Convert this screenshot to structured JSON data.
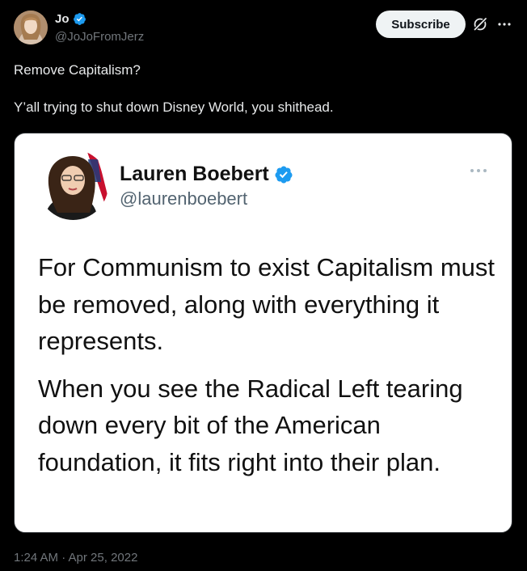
{
  "tweet": {
    "author": {
      "display_name": "Jo",
      "handle": "@JoJoFromJerz",
      "verified": true
    },
    "subscribe_label": "Subscribe",
    "text": [
      "Remove Capitalism?",
      "Y’all trying to shut down Disney World, you shithead."
    ],
    "timestamp": "1:24 AM · Apr 25, 2022"
  },
  "embedded": {
    "author": {
      "display_name": "Lauren Boebert",
      "handle": "@laurenboebert",
      "verified": true
    },
    "text": [
      "For Communism to exist Capitalism must be removed, along with everything it represents.",
      "When you see the Radical Left tearing down every bit of the American foundation, it fits right into their plan."
    ]
  },
  "colors": {
    "background": "#000000",
    "text_primary": "#e7e9ea",
    "text_secondary": "#71767b",
    "verified_blue": "#1d9bf0",
    "button_bg": "#eff3f4"
  },
  "icons": {
    "verified": "verified-badge-icon",
    "grok": "grok-icon",
    "more": "more-dots-icon"
  }
}
